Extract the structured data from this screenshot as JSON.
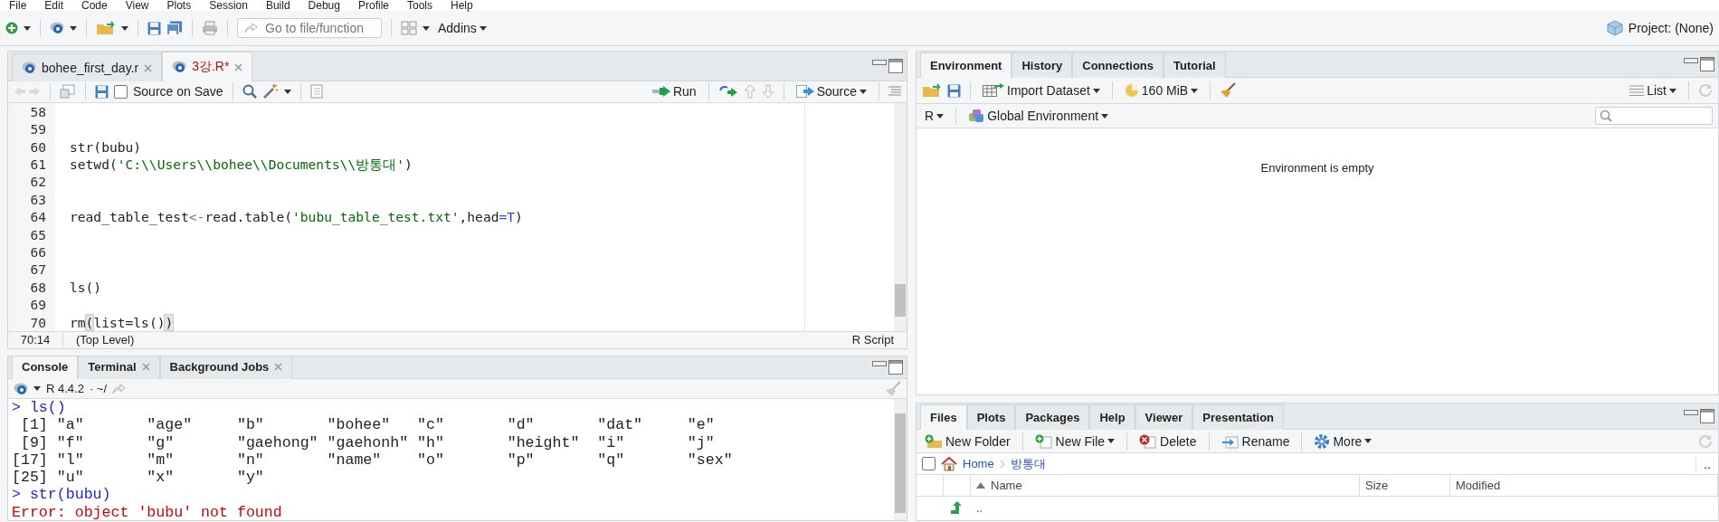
{
  "menu": [
    "File",
    "Edit",
    "Code",
    "View",
    "Plots",
    "Session",
    "Build",
    "Debug",
    "Profile",
    "Tools",
    "Help"
  ],
  "toolbar": {
    "goto_placeholder": "Go to file/function",
    "addins": "Addins",
    "project": "Project: (None)"
  },
  "editor": {
    "tabs": [
      {
        "label": "bohee_first_day.r",
        "selected": false,
        "modified": false,
        "closable": true
      },
      {
        "label": "3강.R*",
        "selected": true,
        "modified": true,
        "closable": true
      }
    ],
    "source_on_save": {
      "label": "Source on Save",
      "checked": false
    },
    "run": "Run",
    "source": "Source",
    "lines": [
      {
        "number": "58"
      },
      {
        "number": "59"
      },
      {
        "number": "60",
        "tokens": [
          {
            "kind": "plain",
            "text": "str(bubu)"
          }
        ]
      },
      {
        "number": "61",
        "tokens": [
          {
            "kind": "plain",
            "text": "setwd("
          },
          {
            "kind": "string",
            "text": "'C:\\\\Users\\\\bohee\\\\Documents\\\\방통대'"
          },
          {
            "kind": "plain",
            "text": ")"
          }
        ]
      },
      {
        "number": "62"
      },
      {
        "number": "63"
      },
      {
        "number": "64",
        "tokens": [
          {
            "kind": "plain",
            "text": "read_table_test"
          },
          {
            "kind": "operator",
            "text": "<-"
          },
          {
            "kind": "plain",
            "text": "read.table("
          },
          {
            "kind": "string",
            "text": "'bubu_table_test.txt'"
          },
          {
            "kind": "plain",
            "text": ",head"
          },
          {
            "kind": "keyword",
            "text": "=T"
          },
          {
            "kind": "plain",
            "text": ")"
          }
        ]
      },
      {
        "number": "65"
      },
      {
        "number": "66"
      },
      {
        "number": "67"
      },
      {
        "number": "68",
        "tokens": [
          {
            "kind": "plain",
            "text": "ls()"
          }
        ]
      },
      {
        "number": "69"
      },
      {
        "number": "70",
        "tokens": [
          {
            "kind": "plain",
            "text": "rm"
          },
          {
            "kind": "bracket",
            "text": "("
          },
          {
            "kind": "plain",
            "text": "list=ls()"
          },
          {
            "kind": "bracket",
            "text": ")"
          }
        ]
      }
    ],
    "position": "70:14",
    "scope": "(Top Level)",
    "file_type": "R Script"
  },
  "console": {
    "tabs": [
      {
        "label": "Console",
        "selected": true,
        "closable": false
      },
      {
        "label": "Terminal",
        "selected": false,
        "closable": true
      },
      {
        "label": "Background Jobs",
        "selected": false,
        "closable": true
      }
    ],
    "version": "R 4.4.2",
    "dir": "· ~/",
    "output": [
      {
        "kind": "input",
        "text": "> ls()"
      },
      {
        "kind": "output",
        "text": " [1] \"a\"       \"age\"     \"b\"       \"bohee\"   \"c\"       \"d\"       \"dat\"     \"e\""
      },
      {
        "kind": "output",
        "text": " [9] \"f\"       \"g\"       \"gaehong\" \"gaehonh\" \"h\"       \"height\"  \"i\"       \"j\""
      },
      {
        "kind": "output",
        "text": "[17] \"l\"       \"m\"       \"n\"       \"name\"    \"o\"       \"p\"       \"q\"       \"sex\""
      },
      {
        "kind": "output",
        "text": "[25] \"u\"       \"x\"       \"y\""
      },
      {
        "kind": "input",
        "text": "> str(bubu)"
      },
      {
        "kind": "error",
        "text": "Error: object 'bubu' not found"
      }
    ]
  },
  "environment": {
    "tabs": [
      {
        "label": "Environment",
        "selected": true
      },
      {
        "label": "History",
        "selected": false
      },
      {
        "label": "Connections",
        "selected": false
      },
      {
        "label": "Tutorial",
        "selected": false
      }
    ],
    "import": "Import Dataset",
    "memory": "160 MiB",
    "view": "List",
    "language": "R",
    "scope": "Global Environment",
    "message": "Environment is empty"
  },
  "files": {
    "tabs": [
      {
        "label": "Files",
        "selected": true
      },
      {
        "label": "Plots",
        "selected": false
      },
      {
        "label": "Packages",
        "selected": false
      },
      {
        "label": "Help",
        "selected": false
      },
      {
        "label": "Viewer",
        "selected": false
      },
      {
        "label": "Presentation",
        "selected": false
      }
    ],
    "actions": [
      {
        "kind": "new-folder",
        "label": "New Folder",
        "menu": false
      },
      {
        "kind": "new-file",
        "label": "New File",
        "menu": true
      },
      {
        "kind": "delete",
        "label": "Delete",
        "menu": false
      },
      {
        "kind": "rename",
        "label": "Rename",
        "menu": false
      },
      {
        "kind": "more",
        "label": "More",
        "menu": true
      }
    ],
    "select_all": {
      "checked": false
    },
    "breadcrumb": [
      "Home",
      "방통대"
    ],
    "overflow": "..",
    "columns": [
      "Name",
      "Size",
      "Modified"
    ],
    "rows": [
      {
        "name": ".."
      }
    ]
  }
}
